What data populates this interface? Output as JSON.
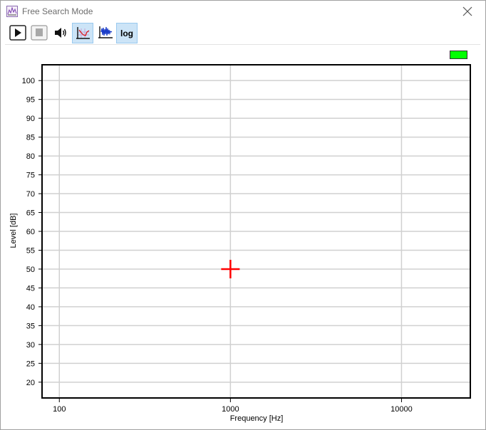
{
  "window": {
    "title": "Free Search Mode",
    "app_icon": "spectrum-icon",
    "close_icon": "close-icon"
  },
  "toolbar": {
    "play": {
      "icon": "play-icon"
    },
    "stop": {
      "icon": "stop-icon"
    },
    "sound": {
      "icon": "speaker-icon"
    },
    "curve": {
      "icon": "frequency-curve-icon",
      "active": true
    },
    "signal": {
      "icon": "signal-waveform-icon",
      "active": false
    },
    "log": {
      "label": "log",
      "active": true
    }
  },
  "status": {
    "color": "#00ff00"
  },
  "chart_data": {
    "type": "scatter",
    "xlabel": "Frequency [Hz]",
    "ylabel": "Level [dB]",
    "x_scale": "log",
    "xlim": [
      80,
      25000
    ],
    "ylim": [
      16,
      104
    ],
    "x_ticks": [
      100,
      1000,
      10000
    ],
    "x_tick_labels": [
      "100",
      "1000",
      "10000"
    ],
    "y_ticks": [
      20,
      25,
      30,
      35,
      40,
      45,
      50,
      55,
      60,
      65,
      70,
      75,
      80,
      85,
      90,
      95,
      100
    ],
    "y_tick_labels": [
      "20",
      "25",
      "30",
      "35",
      "40",
      "45",
      "50",
      "55",
      "60",
      "65",
      "70",
      "75",
      "80",
      "85",
      "90",
      "95",
      "100"
    ],
    "grid": true,
    "cursor": {
      "x": 1000,
      "y": 50,
      "color": "#ff0000",
      "marker": "plus"
    }
  }
}
